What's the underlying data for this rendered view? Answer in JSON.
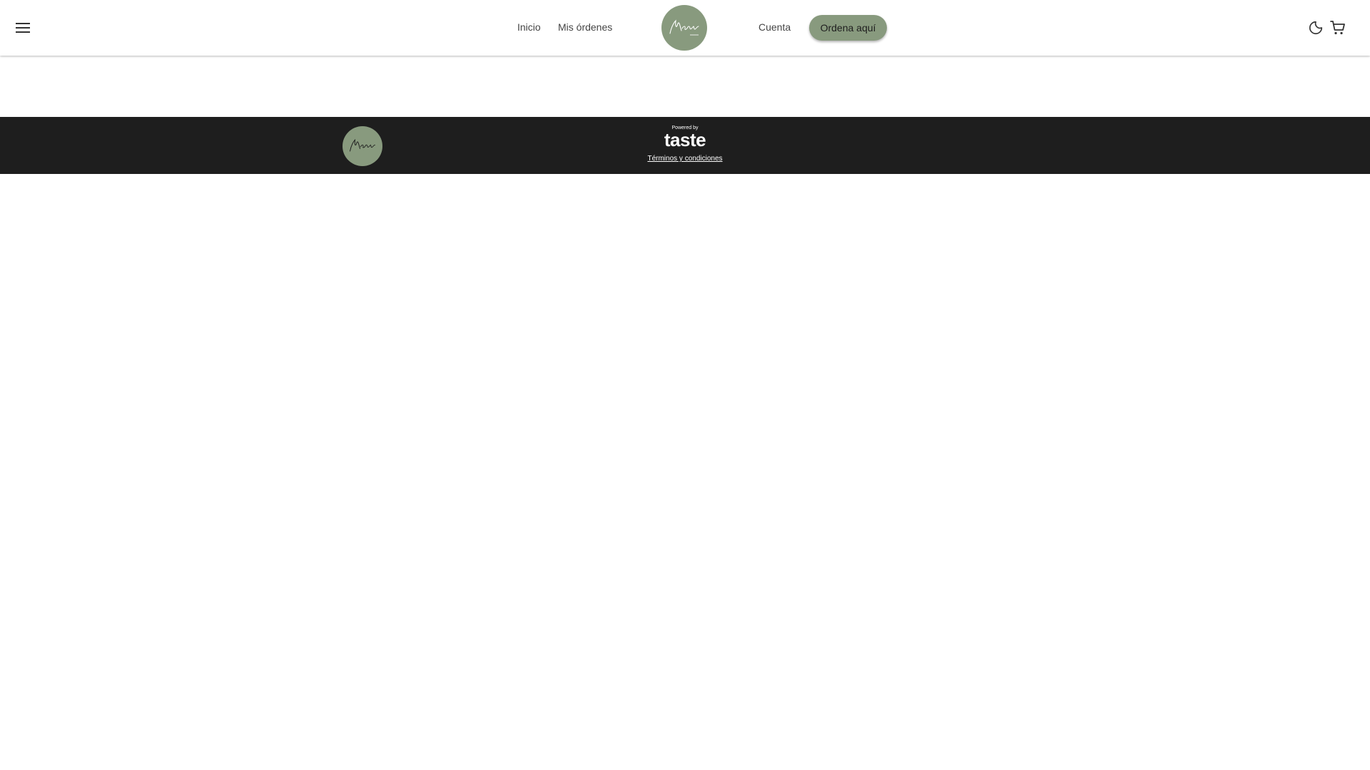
{
  "colors": {
    "accent": "#889a7e",
    "footer_bg": "#1e1e1e",
    "page_bg": "#ffffff"
  },
  "header": {
    "menu_icon": "menu-icon",
    "nav_links": [
      "Inicio",
      "Mis órdenes",
      "Cuenta"
    ],
    "logo_text": "Mosaico",
    "order_button": "Ordena aquí",
    "theme_icon": "moon-icon",
    "cart_icon": "cart-icon"
  },
  "footer": {
    "logo_text": "Mosaico",
    "powered_by": "Powered by",
    "brand": "taste",
    "terms": "Términos y condiciones"
  }
}
